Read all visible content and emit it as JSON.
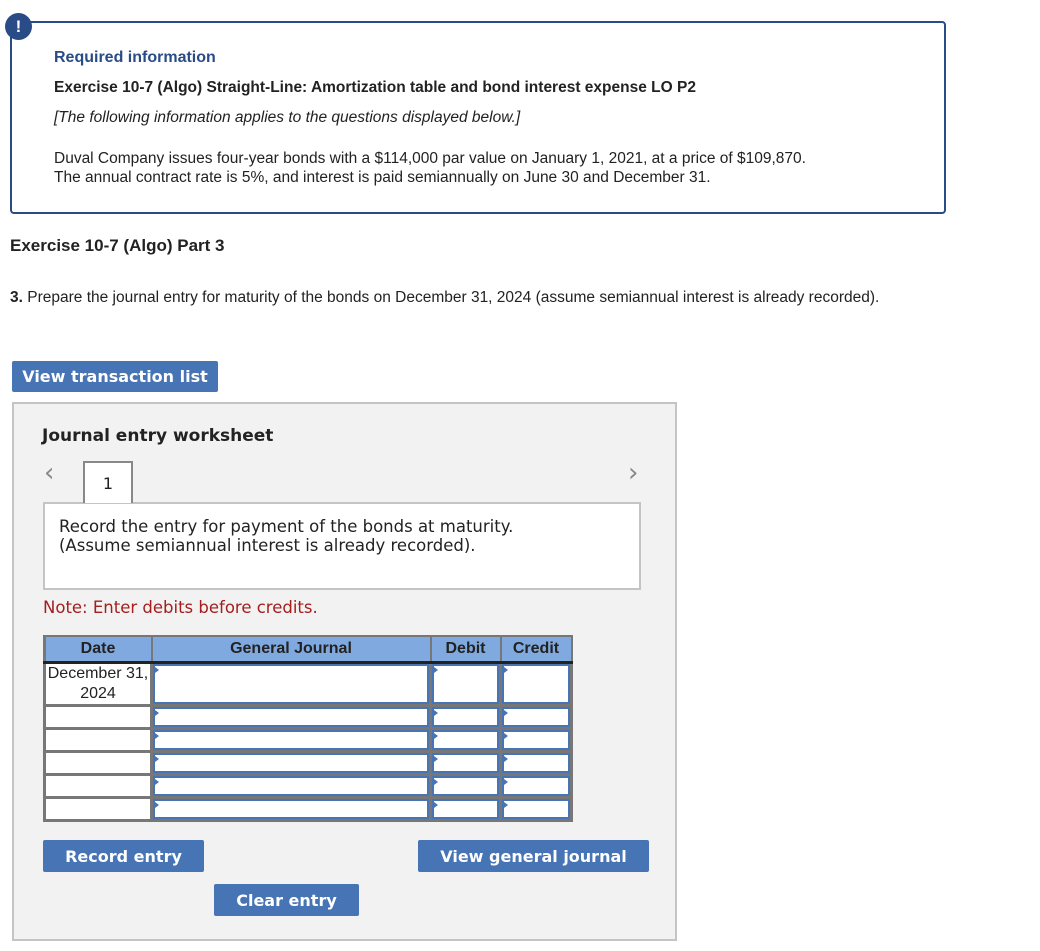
{
  "info": {
    "badge": "!",
    "heading": "Required information",
    "exercise_title": "Exercise 10-7 (Algo) Straight-Line: Amortization table and bond interest expense LO P2",
    "applies_note": "[The following information applies to the questions displayed below.]",
    "description_line1": "Duval Company issues four-year bonds with a $114,000 par value on January 1, 2021, at a price of $109,870.",
    "description_line2": "The annual contract rate is 5%, and interest is paid semiannually on June 30 and December 31."
  },
  "part": {
    "title": "Exercise 10-7 (Algo) Part 3",
    "question_number": "3.",
    "question_text": " Prepare the journal entry for maturity of the bonds on December 31, 2024 (assume semiannual interest is already recorded)."
  },
  "buttons": {
    "view_transaction_list": "View transaction list",
    "record_entry": "Record entry",
    "clear_entry": "Clear entry",
    "view_general_journal": "View general journal"
  },
  "worksheet": {
    "title": "Journal entry worksheet",
    "prev_icon": "chevron-left",
    "next_icon": "chevron-right",
    "active_tab": "1",
    "prompt_line1": "Record the entry for payment of the bonds at maturity.",
    "prompt_line2": "(Assume semiannual interest is already recorded).",
    "note": "Note: Enter debits before credits.",
    "table": {
      "headers": {
        "date": "Date",
        "general_journal": "General Journal",
        "debit": "Debit",
        "credit": "Credit"
      },
      "rows": [
        {
          "date": "December 31, 2024",
          "account": "",
          "debit": "",
          "credit": ""
        },
        {
          "date": "",
          "account": "",
          "debit": "",
          "credit": ""
        },
        {
          "date": "",
          "account": "",
          "debit": "",
          "credit": ""
        },
        {
          "date": "",
          "account": "",
          "debit": "",
          "credit": ""
        },
        {
          "date": "",
          "account": "",
          "debit": "",
          "credit": ""
        },
        {
          "date": "",
          "account": "",
          "debit": "",
          "credit": ""
        }
      ]
    }
  },
  "colors": {
    "brand_blue": "#294b86",
    "button_blue": "#4774b4",
    "header_blue": "#80aadf",
    "note_red": "#a41e1e"
  }
}
